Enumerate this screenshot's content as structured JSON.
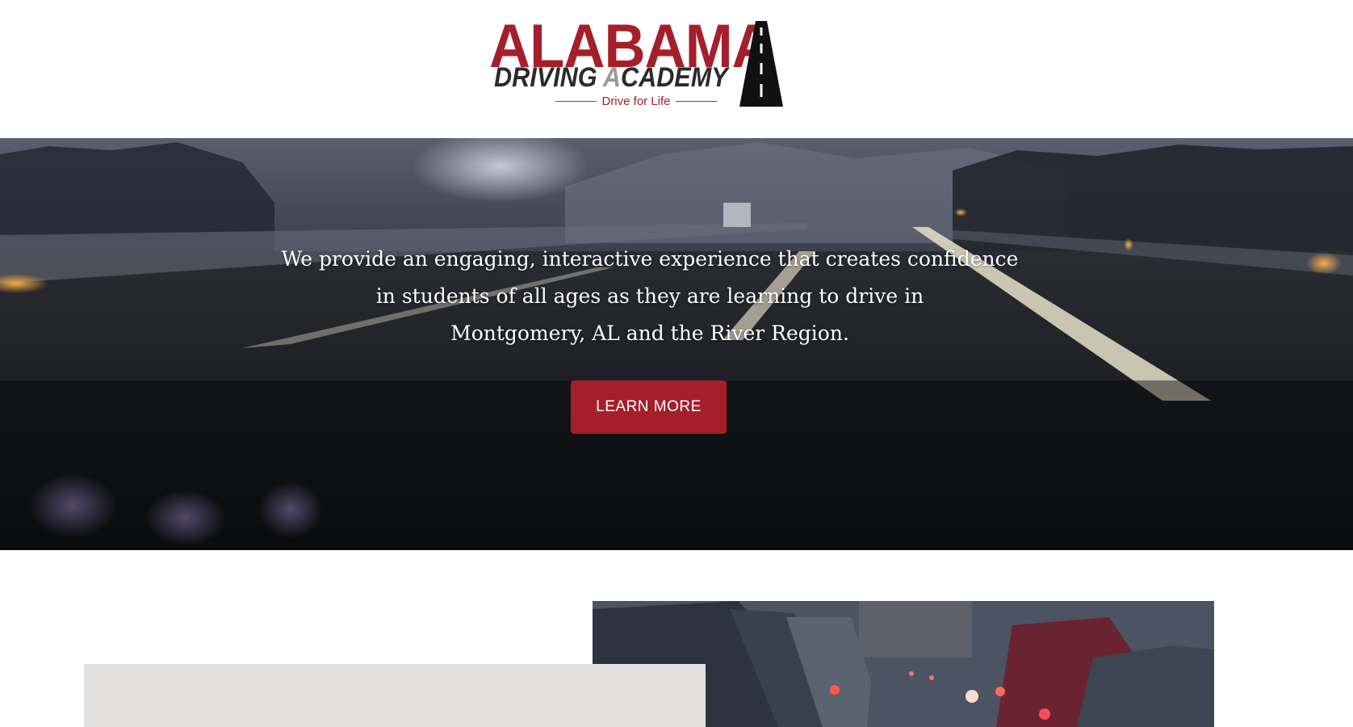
{
  "logo": {
    "line1": "ALABAMA",
    "line2_part1": "DRIVING ",
    "line2_part2": "A",
    "line2_part3": "CADEMY",
    "tagline": "Drive for Life",
    "brand_color": "#a51f2b"
  },
  "hero": {
    "line1": "We provide an engaging, interactive experience that creates confidence",
    "line2": "in students of all ages as they are learning to drive in",
    "line3": "Montgomery, AL and the River Region.",
    "button_label": "LEARN MORE",
    "button_color": "#a51f2b"
  },
  "lower": {
    "panel_color": "#e3e2e0"
  }
}
